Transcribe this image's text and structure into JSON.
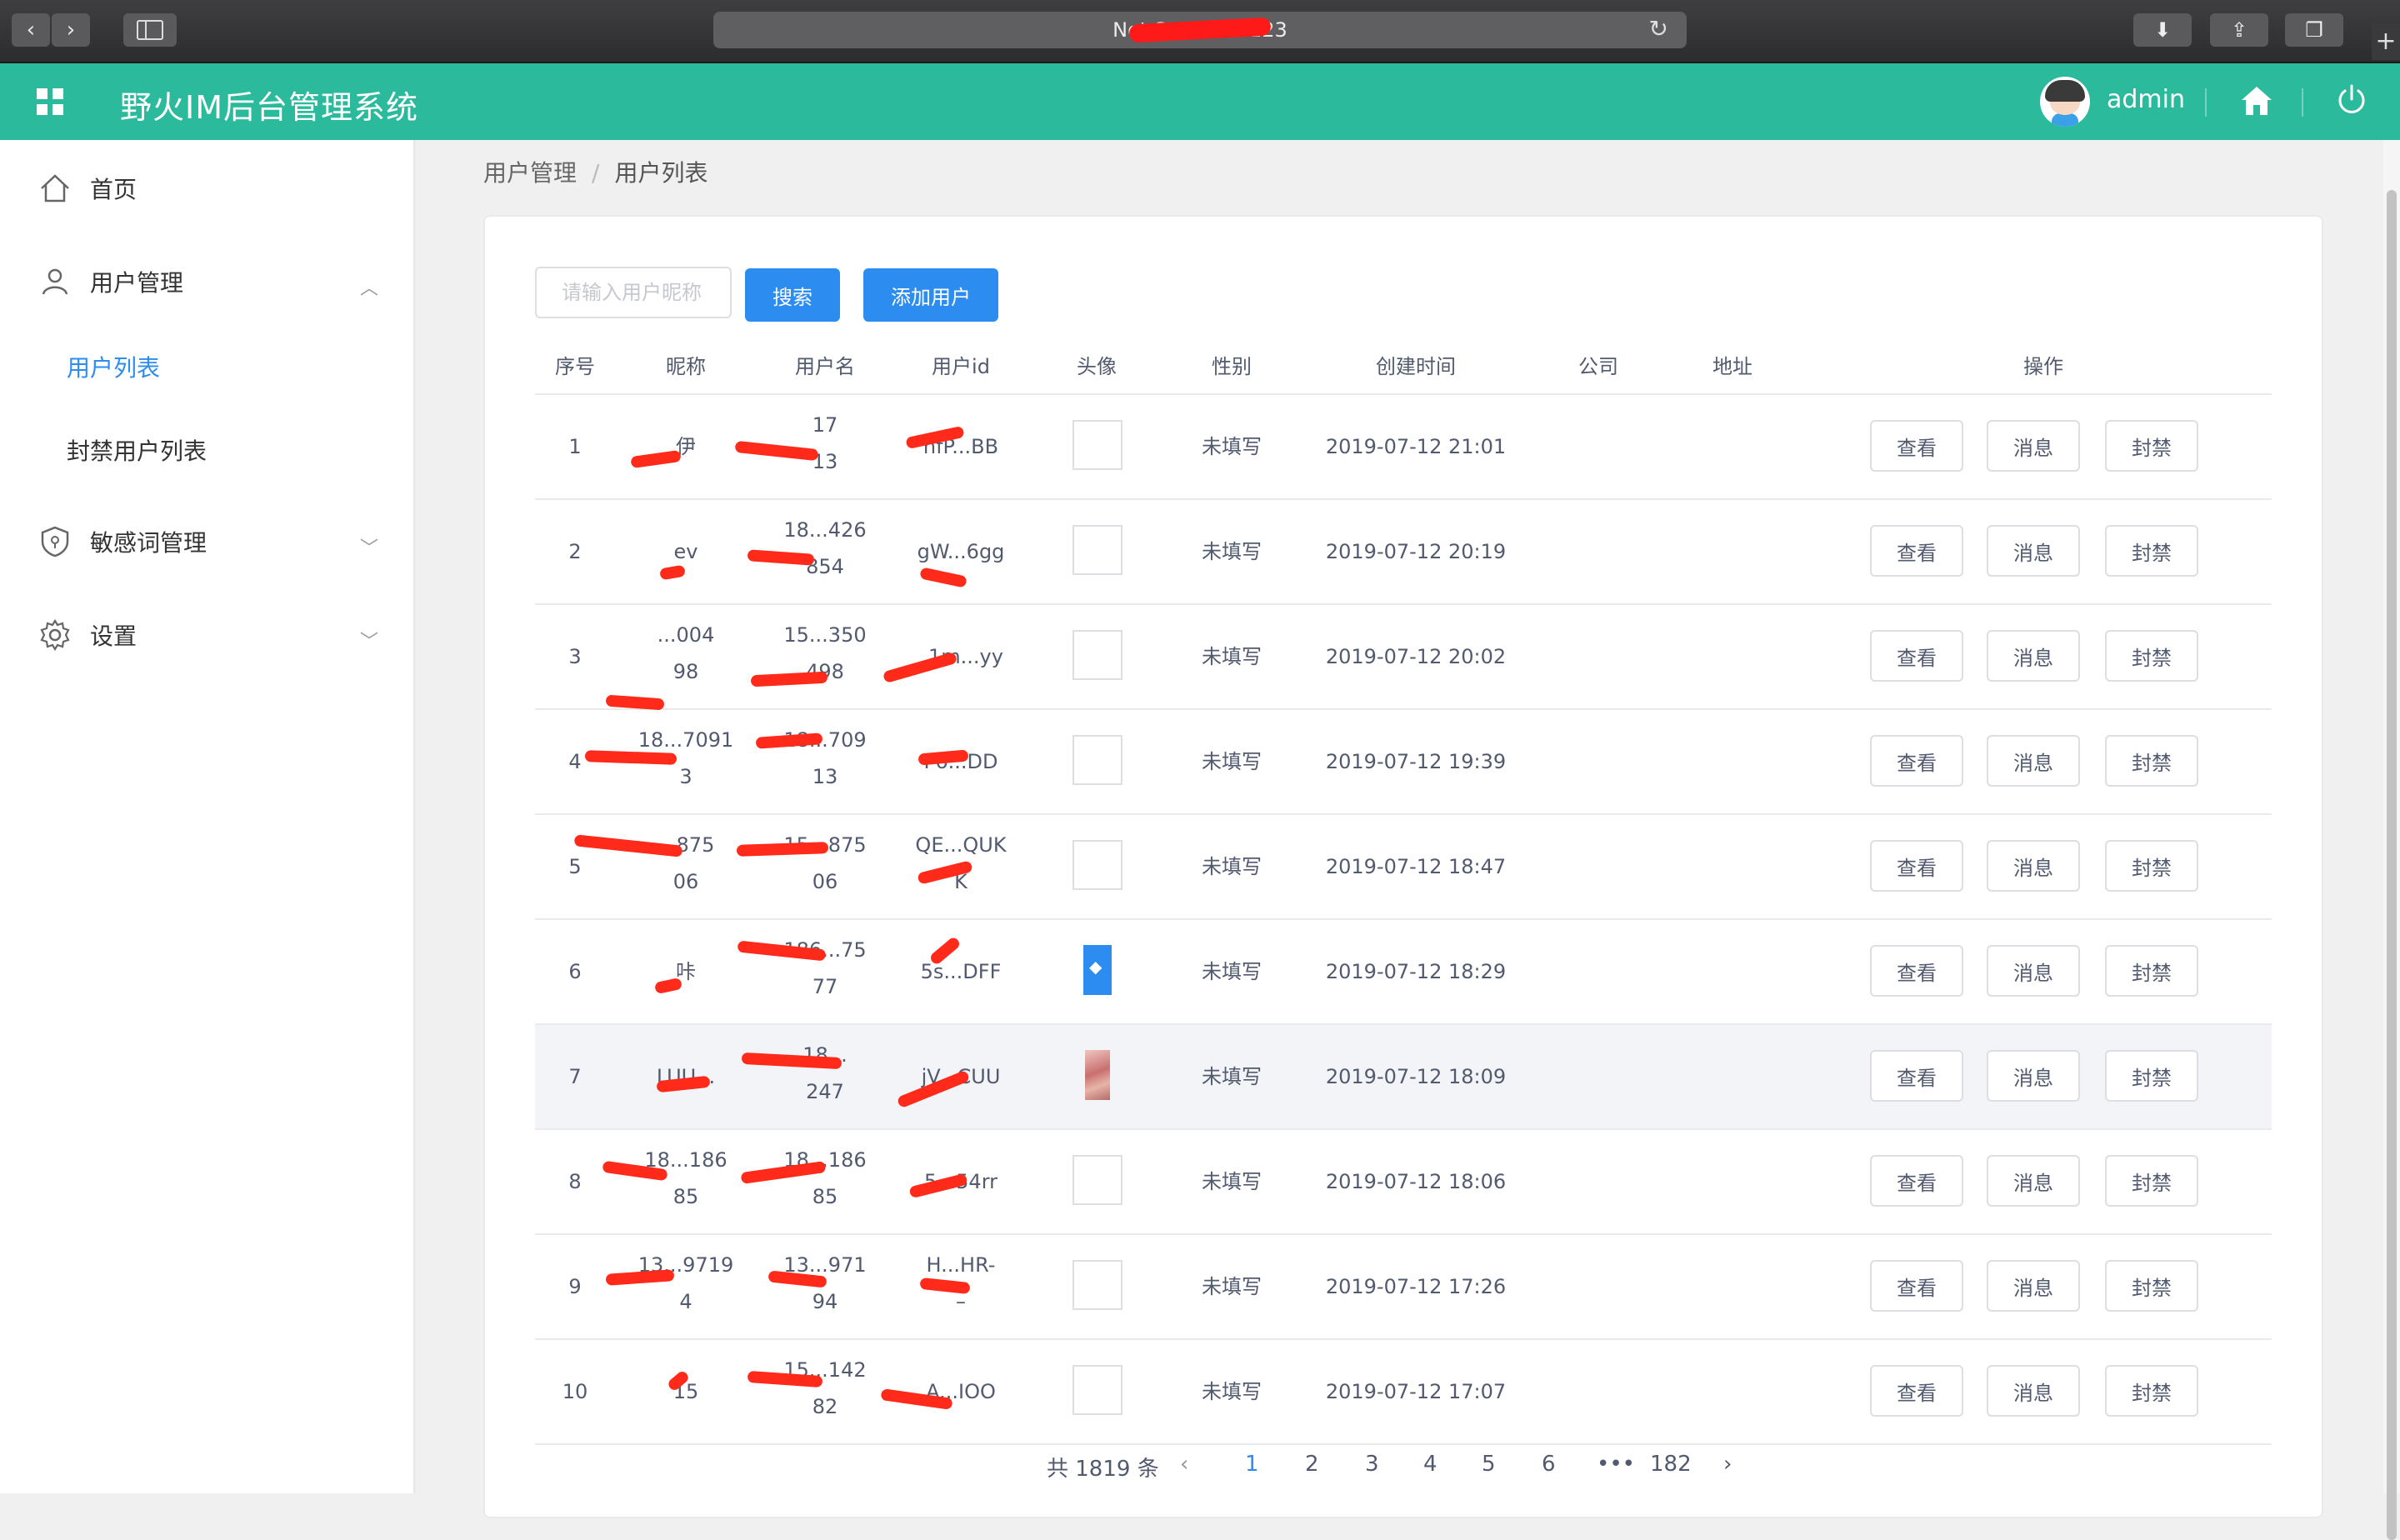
{
  "browser": {
    "address_prefix": "Not Secure —",
    "address_suffix": "123"
  },
  "header": {
    "title": "野火IM后台管理系统",
    "username": "admin",
    "accent": "#2bbb9c"
  },
  "sidebar": {
    "items": [
      {
        "label": "首页",
        "icon": "home-icon"
      },
      {
        "label": "用户管理",
        "icon": "user-icon"
      },
      {
        "label": "敏感词管理",
        "icon": "shield-icon"
      },
      {
        "label": "设置",
        "icon": "gear-icon"
      }
    ],
    "sub_items": [
      {
        "label": "用户列表",
        "active": true
      },
      {
        "label": "封禁用户列表",
        "active": false
      }
    ]
  },
  "breadcrumb": {
    "parent": "用户管理",
    "separator": "/",
    "current": "用户列表"
  },
  "toolbar": {
    "search_placeholder": "请输入用户昵称",
    "search_label": "搜索",
    "add_label": "添加用户"
  },
  "table": {
    "columns": [
      "序号",
      "昵称",
      "用户名",
      "用户id",
      "头像",
      "性别",
      "创建时间",
      "公司",
      "地址",
      "操作"
    ],
    "rows": [
      {
        "index": "1",
        "nickname": "伊",
        "username": [
          "17",
          "13"
        ],
        "userid": "nfP...BB",
        "gender": "未填写",
        "created": "2019-07-12 21:01",
        "avatar": "empty"
      },
      {
        "index": "2",
        "nickname": "ev",
        "username": [
          "18...426",
          "854"
        ],
        "userid": "gW...6gg",
        "gender": "未填写",
        "created": "2019-07-12 20:19",
        "avatar": "empty"
      },
      {
        "index": "3",
        "nickname": [
          "...004",
          "98"
        ],
        "username": [
          "15...350",
          "498"
        ],
        "userid": "_1m...yy",
        "gender": "未填写",
        "created": "2019-07-12 20:02",
        "avatar": "empty"
      },
      {
        "index": "4",
        "nickname": [
          "18...7091",
          "3"
        ],
        "username": [
          "18...709",
          "13"
        ],
        "userid": "F6...DD",
        "gender": "未填写",
        "created": "2019-07-12 19:39",
        "avatar": "empty"
      },
      {
        "index": "5",
        "nickname": [
          "...875",
          "06"
        ],
        "username": [
          "15...875",
          "06"
        ],
        "userid": [
          "QE...QUK",
          "K"
        ],
        "gender": "未填写",
        "created": "2019-07-12 18:47",
        "avatar": "empty"
      },
      {
        "index": "6",
        "nickname": "咔",
        "username": [
          "186...75",
          "77"
        ],
        "userid": "5s...DFF",
        "gender": "未填写",
        "created": "2019-07-12 18:29",
        "avatar": "blue"
      },
      {
        "index": "7",
        "nickname": "LUU...",
        "username": [
          "18...",
          "247"
        ],
        "userid": "jV...CUU",
        "gender": "未填写",
        "created": "2019-07-12 18:09",
        "avatar": "photo"
      },
      {
        "index": "8",
        "nickname": [
          "18...186",
          "85"
        ],
        "username": [
          "18...186",
          "85"
        ],
        "userid": "5...54rr",
        "gender": "未填写",
        "created": "2019-07-12 18:06",
        "avatar": "empty"
      },
      {
        "index": "9",
        "nickname": [
          "13...9719",
          "4"
        ],
        "username": [
          "13...971",
          "94"
        ],
        "userid": [
          "H...HR-",
          "–"
        ],
        "gender": "未填写",
        "created": "2019-07-12 17:26",
        "avatar": "empty"
      },
      {
        "index": "10",
        "nickname": "15",
        "username": [
          "15...142",
          "82"
        ],
        "userid": "A...IOO",
        "gender": "未填写",
        "created": "2019-07-12 17:07",
        "avatar": "empty"
      }
    ],
    "actions": [
      "查看",
      "消息",
      "封禁"
    ]
  },
  "pagination": {
    "total_text": "共 1819 条",
    "pages": [
      "1",
      "2",
      "3",
      "4",
      "5",
      "6"
    ],
    "ellipsis": "•••",
    "last_page": "182",
    "current": "1"
  }
}
